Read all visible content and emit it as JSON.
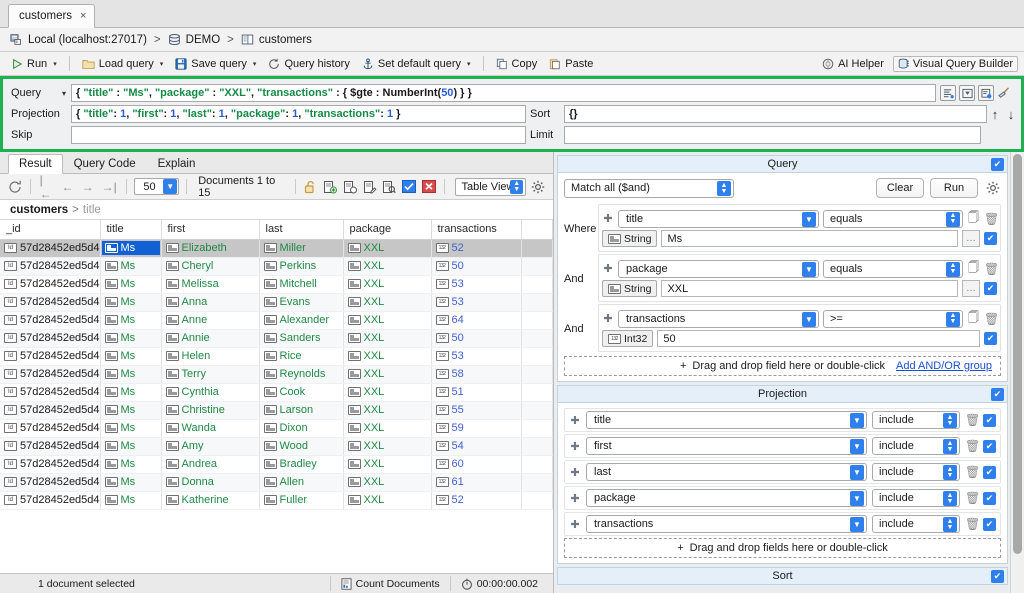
{
  "tab": {
    "title": "customers",
    "close": "×"
  },
  "breadcrumb": {
    "connection": "Local (localhost:27017)",
    "database": "DEMO",
    "collection": "customers",
    "separator": ">"
  },
  "toolbar": {
    "run": "Run",
    "load_query": "Load query",
    "save_query": "Save query",
    "query_history": "Query history",
    "set_default_query": "Set default query",
    "copy": "Copy",
    "paste": "Paste",
    "ai_helper": "AI Helper",
    "visual_query_builder": "Visual Query Builder",
    "caret": "▾"
  },
  "query_editor": {
    "query_label": "Query",
    "projection_label": "Projection",
    "skip_label": "Skip",
    "sort_label": "Sort",
    "limit_label": "Limit",
    "query_value": "{ \"title\" : \"Ms\", \"package\" : \"XXL\", \"transactions\" : { $gte : NumberInt(50) } }",
    "query_tokens": [
      {
        "t": "{ ",
        "k": "pl"
      },
      {
        "t": "\"title\"",
        "k": "str"
      },
      {
        "t": " : ",
        "k": "pl"
      },
      {
        "t": "\"Ms\"",
        "k": "str"
      },
      {
        "t": ", ",
        "k": "pl"
      },
      {
        "t": "\"package\"",
        "k": "str"
      },
      {
        "t": " : ",
        "k": "pl"
      },
      {
        "t": "\"XXL\"",
        "k": "str"
      },
      {
        "t": ", ",
        "k": "pl"
      },
      {
        "t": "\"transactions\"",
        "k": "str"
      },
      {
        "t": " : { $gte : NumberInt(",
        "k": "pl"
      },
      {
        "t": "50",
        "k": "num"
      },
      {
        "t": ") } }",
        "k": "pl"
      }
    ],
    "projection_value": "{ \"title\": 1, \"first\": 1, \"last\": 1, \"package\": 1, \"transactions\": 1 }",
    "projection_tokens": [
      {
        "t": "{ ",
        "k": "pl"
      },
      {
        "t": "\"title\"",
        "k": "str"
      },
      {
        "t": ": ",
        "k": "pl"
      },
      {
        "t": "1",
        "k": "num"
      },
      {
        "t": ", ",
        "k": "pl"
      },
      {
        "t": "\"first\"",
        "k": "str"
      },
      {
        "t": ": ",
        "k": "pl"
      },
      {
        "t": "1",
        "k": "num"
      },
      {
        "t": ", ",
        "k": "pl"
      },
      {
        "t": "\"last\"",
        "k": "str"
      },
      {
        "t": ": ",
        "k": "pl"
      },
      {
        "t": "1",
        "k": "num"
      },
      {
        "t": ", ",
        "k": "pl"
      },
      {
        "t": "\"package\"",
        "k": "str"
      },
      {
        "t": ": ",
        "k": "pl"
      },
      {
        "t": "1",
        "k": "num"
      },
      {
        "t": ", ",
        "k": "pl"
      },
      {
        "t": "\"transactions\"",
        "k": "str"
      },
      {
        "t": ": ",
        "k": "pl"
      },
      {
        "t": "1",
        "k": "num"
      },
      {
        "t": " }",
        "k": "pl"
      }
    ],
    "skip_value": "",
    "sort_value": "{}",
    "limit_value": "",
    "up_arrow": "↑",
    "down_arrow": "↓"
  },
  "result": {
    "tabs": [
      {
        "label": "Result",
        "active": true
      },
      {
        "label": "Query Code",
        "active": false
      },
      {
        "label": "Explain",
        "active": false
      }
    ],
    "page_size": "50",
    "documents_label": "Documents 1 to 15",
    "view_mode": "Table View",
    "path_collection": "customers",
    "path_sep": ">",
    "path_field": "title",
    "columns": [
      "_id",
      "title",
      "first",
      "last",
      "package",
      "transactions"
    ],
    "rows": [
      {
        "_id": "57d28452ed5d4",
        "title": "Ms",
        "first": "Elizabeth",
        "last": "Miller",
        "package": "XXL",
        "transactions": "52"
      },
      {
        "_id": "57d28452ed5d4",
        "title": "Ms",
        "first": "Cheryl",
        "last": "Perkins",
        "package": "XXL",
        "transactions": "50"
      },
      {
        "_id": "57d28452ed5d4",
        "title": "Ms",
        "first": "Melissa",
        "last": "Mitchell",
        "package": "XXL",
        "transactions": "53"
      },
      {
        "_id": "57d28452ed5d4",
        "title": "Ms",
        "first": "Anna",
        "last": "Evans",
        "package": "XXL",
        "transactions": "53"
      },
      {
        "_id": "57d28452ed5d4",
        "title": "Ms",
        "first": "Anne",
        "last": "Alexander",
        "package": "XXL",
        "transactions": "64"
      },
      {
        "_id": "57d28452ed5d4",
        "title": "Ms",
        "first": "Annie",
        "last": "Sanders",
        "package": "XXL",
        "transactions": "50"
      },
      {
        "_id": "57d28452ed5d4",
        "title": "Ms",
        "first": "Helen",
        "last": "Rice",
        "package": "XXL",
        "transactions": "53"
      },
      {
        "_id": "57d28452ed5d4",
        "title": "Ms",
        "first": "Terry",
        "last": "Reynolds",
        "package": "XXL",
        "transactions": "58"
      },
      {
        "_id": "57d28452ed5d4",
        "title": "Ms",
        "first": "Cynthia",
        "last": "Cook",
        "package": "XXL",
        "transactions": "51"
      },
      {
        "_id": "57d28452ed5d4",
        "title": "Ms",
        "first": "Christine",
        "last": "Larson",
        "package": "XXL",
        "transactions": "55"
      },
      {
        "_id": "57d28452ed5d4",
        "title": "Ms",
        "first": "Wanda",
        "last": "Dixon",
        "package": "XXL",
        "transactions": "59"
      },
      {
        "_id": "57d28452ed5d4",
        "title": "Ms",
        "first": "Amy",
        "last": "Wood",
        "package": "XXL",
        "transactions": "54"
      },
      {
        "_id": "57d28452ed5d4",
        "title": "Ms",
        "first": "Andrea",
        "last": "Bradley",
        "package": "XXL",
        "transactions": "60"
      },
      {
        "_id": "57d28452ed5d4",
        "title": "Ms",
        "first": "Donna",
        "last": "Allen",
        "package": "XXL",
        "transactions": "61"
      },
      {
        "_id": "57d28452ed5d4",
        "title": "Ms",
        "first": "Katherine",
        "last": "Fuller",
        "package": "XXL",
        "transactions": "52"
      }
    ]
  },
  "status": {
    "selection": "1 document selected",
    "count_documents": "Count Documents",
    "elapsed": "00:00:00.002"
  },
  "vqb": {
    "query_section_title": "Query",
    "projection_section_title": "Projection",
    "sort_section_title": "Sort",
    "match_mode": "Match all ($and)",
    "clear_button": "Clear",
    "run_button": "Run",
    "where_label": "Where",
    "and_label": "And",
    "conditions": [
      {
        "joiner": "Where",
        "field": "title",
        "operator": "equals",
        "type": "String",
        "value": "Ms",
        "has_dots": true
      },
      {
        "joiner": "And",
        "field": "package",
        "operator": "equals",
        "type": "String",
        "value": "XXL",
        "has_dots": true
      },
      {
        "joiner": "And",
        "field": "transactions",
        "operator": ">=",
        "type": "Int32",
        "value": "50",
        "has_dots": false
      }
    ],
    "query_dropzone": "Drag and drop field here or double-click",
    "add_group_link": "Add AND/OR group",
    "projection_rows": [
      {
        "field": "title",
        "mode": "include"
      },
      {
        "field": "first",
        "mode": "include"
      },
      {
        "field": "last",
        "mode": "include"
      },
      {
        "field": "package",
        "mode": "include"
      },
      {
        "field": "transactions",
        "mode": "include"
      }
    ],
    "projection_dropzone": "Drag and drop fields here or double-click",
    "check_glyph": "✔",
    "plus_glyph": "+"
  },
  "colors": {
    "accent_blue": "#2f80ed",
    "highlight_green": "#1eb14f",
    "selection_blue": "#1161d5",
    "value_green": "#1f8a45",
    "value_blue": "#3f5fd0",
    "section_header_bg": "#e4eff9"
  }
}
